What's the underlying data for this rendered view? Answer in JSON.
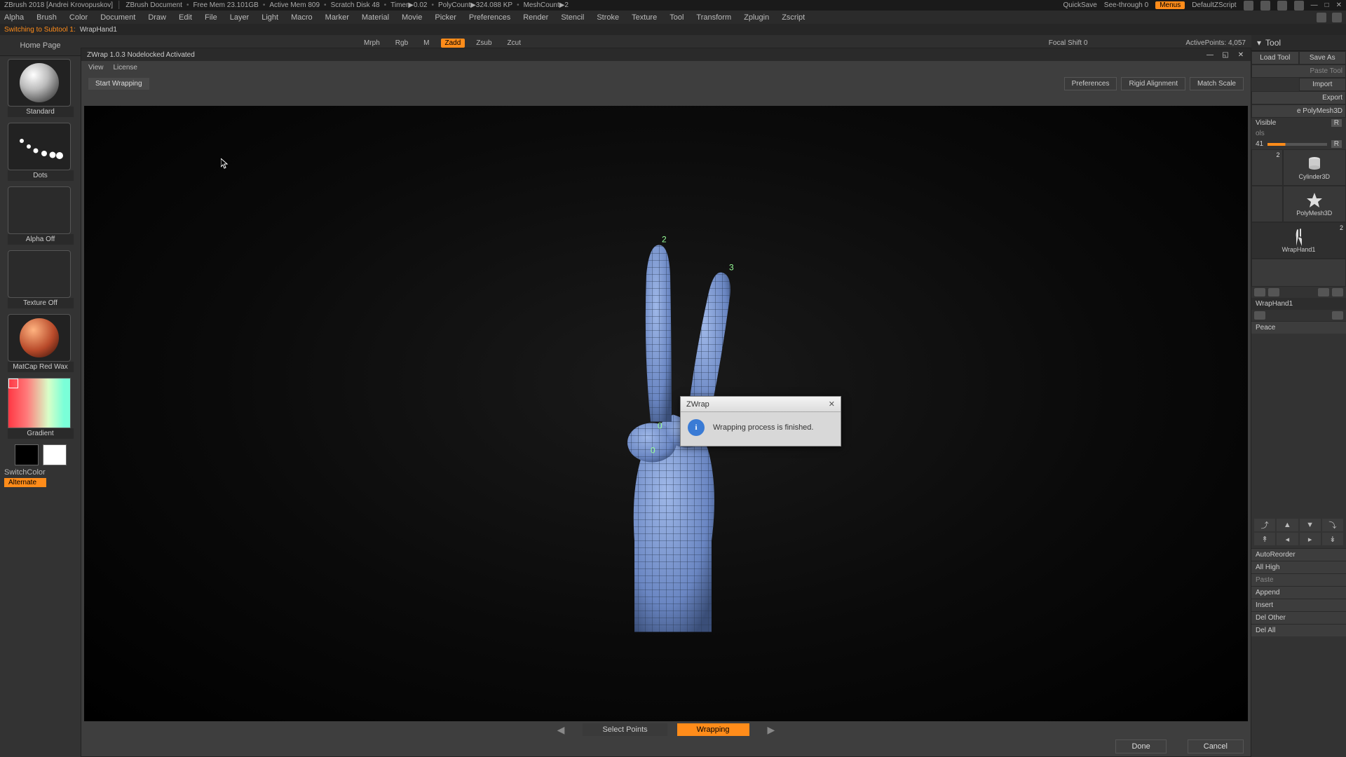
{
  "title": {
    "app": "ZBrush 2018 [Andrei Krovopuskov]",
    "doc": "ZBrush Document",
    "freemem": "Free Mem 23.101GB",
    "activemem": "Active Mem 809",
    "scratch": "Scratch Disk 48",
    "timer": "Timer▶0.02",
    "polycount": "PolyCount▶324.088 KP",
    "meshcount": "MeshCount▶2",
    "quicksave": "QuickSave",
    "seethrough": "See-through  0",
    "menus": "Menus",
    "zscript": "DefaultZScript"
  },
  "menu": [
    "Alpha",
    "Brush",
    "Color",
    "Document",
    "Draw",
    "Edit",
    "File",
    "Layer",
    "Light",
    "Macro",
    "Marker",
    "Material",
    "Movie",
    "Picker",
    "Preferences",
    "Render",
    "Stencil",
    "Stroke",
    "Texture",
    "Tool",
    "Transform",
    "Zplugin",
    "Zscript"
  ],
  "switching": {
    "label": "Switching to Subtool 1:",
    "value": "WrapHand1"
  },
  "home_tab": "Home Page",
  "left": {
    "standard": "Standard",
    "dots": "Dots",
    "alpha_off": "Alpha Off",
    "texture_off": "Texture Off",
    "matcap": "MatCap Red Wax",
    "gradient": "Gradient",
    "switchcolor": "SwitchColor",
    "alternate": "Alternate"
  },
  "toolbar2": {
    "mrph": "Mrph",
    "rgb": "Rgb",
    "m": "M",
    "zadd": "Zadd",
    "zsub": "Zsub",
    "zcut": "Zcut",
    "focal": "Focal Shift 0",
    "active": "ActivePoints: 4,057"
  },
  "zwrap": {
    "title": "ZWrap 1.0.3  Nodelocked Activated",
    "menu": [
      "View",
      "License"
    ],
    "start": "Start Wrapping",
    "prefs": "Preferences",
    "rigid": "Rigid Alignment",
    "match": "Match Scale",
    "steps": {
      "select": "Select Points",
      "wrapping": "Wrapping"
    },
    "done": "Done",
    "cancel": "Cancel",
    "markers": {
      "p2": "2",
      "p3": "3",
      "p0a": "0",
      "p0b": "0"
    }
  },
  "dialog": {
    "title": "ZWrap",
    "body": "Wrapping process is finished.",
    "icon": "i"
  },
  "tool": {
    "header": "Tool",
    "load": "Load Tool",
    "saveas": "Save As",
    "pastetool": "Paste Tool",
    "import": "Import",
    "export": "Export",
    "makepm": "e PolyMesh3D",
    "visible": "Visible",
    "r1": "R",
    "ols": "ols",
    "v41": "41",
    "r2": "R",
    "items": {
      "cyl": "Cylinder3D",
      "pm": "PolyMesh3D",
      "wh": "WrapHand1",
      "two": "2"
    },
    "subtool_header": "WrapHand1",
    "peace": "Peace",
    "ops": [
      "AutoReorder",
      "All High",
      "Paste",
      "Append",
      "Insert",
      "Del Other",
      "Del All"
    ]
  }
}
